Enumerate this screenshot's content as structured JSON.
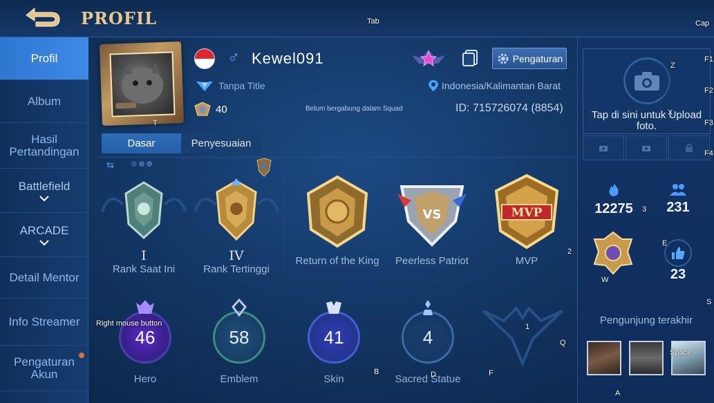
{
  "header": {
    "title": "PROFIL",
    "back_icon": "back-arrow-icon"
  },
  "sidebar": {
    "items": [
      {
        "label": "Profil",
        "active": true
      },
      {
        "label": "Album"
      },
      {
        "label": "Hasil Pertandingan"
      },
      {
        "label": "Battlefield",
        "expandable": true
      },
      {
        "label": "ARCADE",
        "expandable": true
      },
      {
        "label": "Detail Mentor"
      },
      {
        "label": "Info Streamer"
      },
      {
        "label": "Pengaturan Akun",
        "notification": true
      }
    ]
  },
  "profile": {
    "username": "Kewel091",
    "gender_symbol": "♂",
    "title": "Tanpa Title",
    "squad_count": "40",
    "squad_status": "Belum bergabung dalam Squad",
    "location": "Indonesia/Kalimantan Barat",
    "user_id": "ID: 715726074 (8854)",
    "settings_label": "Pengaturan"
  },
  "tabs": [
    {
      "label": "Dasar",
      "active": true
    },
    {
      "label": "Penyesuaian",
      "active": false
    }
  ],
  "ranks": [
    {
      "roman": "I",
      "label": "Rank Saat Ini",
      "icon": "mythic-rank-emblem"
    },
    {
      "roman": "IV",
      "label": "Rank Tertinggi",
      "icon": "gold-rank-emblem"
    },
    {
      "label": "Return of the King",
      "icon": "return-of-king-badge"
    },
    {
      "label": "Peerless Patriot",
      "icon": "peerless-patriot-badge"
    },
    {
      "label": "MVP",
      "icon": "mvp-badge"
    }
  ],
  "stats": [
    {
      "value": "46",
      "label": "Hero",
      "color": "#a976ff"
    },
    {
      "value": "58",
      "label": "Emblem",
      "color": "#7fd1bd"
    },
    {
      "value": "41",
      "label": "Skin",
      "color": "#7b9cff"
    },
    {
      "value": "4",
      "label": "Sacred Statue",
      "color": "#9cc3ff"
    }
  ],
  "right_panel": {
    "upload_text": "Tap di sini untuk Upload foto.",
    "popularity": "12275",
    "followers": "231",
    "likes": "23",
    "visitors_label": "Pengunjung terakhir"
  },
  "overlay_keys": {
    "tab": "Tab",
    "cap": "Cap",
    "f1": "F1",
    "f2": "F2",
    "f3": "F3",
    "f4": "F4",
    "z": "Z",
    "x": "X",
    "t": "T",
    "three": "3",
    "two": "2",
    "e": "E",
    "w": "W",
    "s": "S",
    "one": "1",
    "q": "Q",
    "b": "B",
    "d": "D",
    "f": "F",
    "a": "A",
    "space": "Space",
    "rmb": "Right mouse button"
  }
}
